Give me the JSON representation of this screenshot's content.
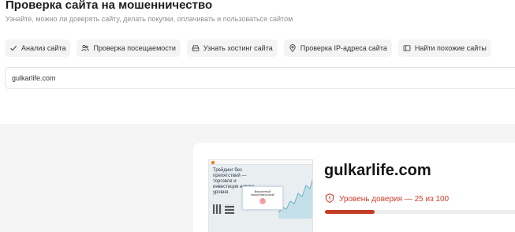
{
  "page": {
    "title": "Проверка сайта на мошенничество",
    "subtitle": "Узнайте, можно ли доверять сайту, делать покупки, оплачивать и пользоваться сайтом"
  },
  "tools": [
    {
      "label": "Анализ сайта",
      "icon": "check-icon"
    },
    {
      "label": "Проверка посещаемости",
      "icon": "users-icon"
    },
    {
      "label": "Узнать хостинг сайта",
      "icon": "server-icon"
    },
    {
      "label": "Проверка IP-адреса сайта",
      "icon": "location-pin-icon"
    },
    {
      "label": "Найти похожие сайты",
      "icon": "browser-window-icon"
    }
  ],
  "search": {
    "value": "gulkarlife.com"
  },
  "result": {
    "domain": "gulkarlife.com",
    "trust_label": "Уровень доверия — 25 из 100",
    "trust_score": 25,
    "trust_max": 100,
    "trust_color": "#c23e27",
    "trust_icon": "shield-warning-icon"
  }
}
